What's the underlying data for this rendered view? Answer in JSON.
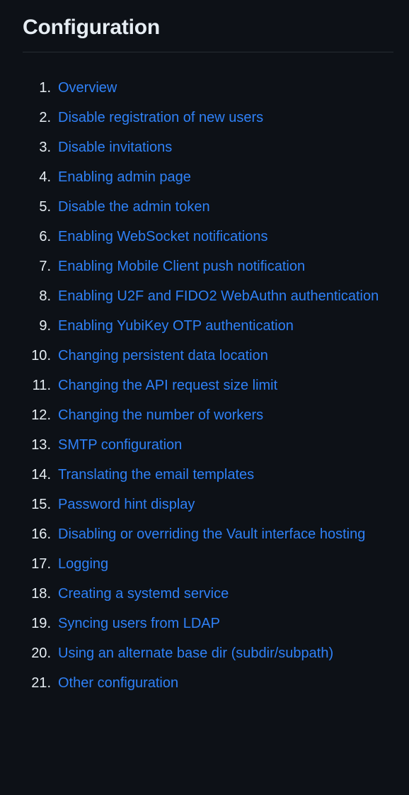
{
  "theme": {
    "background": "#0d1117",
    "title_color": "#e6edf3",
    "link_color": "#2f81f7",
    "rule_color": "#272c33",
    "number_color": "#e6edf3"
  },
  "header": {
    "title": "Configuration"
  },
  "toc": {
    "items": [
      {
        "number": "1.",
        "label": "Overview"
      },
      {
        "number": "2.",
        "label": "Disable registration of new users"
      },
      {
        "number": "3.",
        "label": "Disable invitations"
      },
      {
        "number": "4.",
        "label": "Enabling admin page"
      },
      {
        "number": "5.",
        "label": "Disable the admin token"
      },
      {
        "number": "6.",
        "label": "Enabling WebSocket notifications"
      },
      {
        "number": "7.",
        "label": "Enabling Mobile Client push notification"
      },
      {
        "number": "8.",
        "label": "Enabling U2F and FIDO2 WebAuthn authentication"
      },
      {
        "number": "9.",
        "label": "Enabling YubiKey OTP authentication"
      },
      {
        "number": "10.",
        "label": "Changing persistent data location"
      },
      {
        "number": "11.",
        "label": "Changing the API request size limit"
      },
      {
        "number": "12.",
        "label": "Changing the number of workers"
      },
      {
        "number": "13.",
        "label": "SMTP configuration"
      },
      {
        "number": "14.",
        "label": "Translating the email templates"
      },
      {
        "number": "15.",
        "label": "Password hint display"
      },
      {
        "number": "16.",
        "label": "Disabling or overriding the Vault interface hosting"
      },
      {
        "number": "17.",
        "label": "Logging"
      },
      {
        "number": "18.",
        "label": "Creating a systemd service"
      },
      {
        "number": "19.",
        "label": "Syncing users from LDAP"
      },
      {
        "number": "20.",
        "label": "Using an alternate base dir (subdir/subpath)"
      },
      {
        "number": "21.",
        "label": "Other configuration"
      }
    ]
  }
}
